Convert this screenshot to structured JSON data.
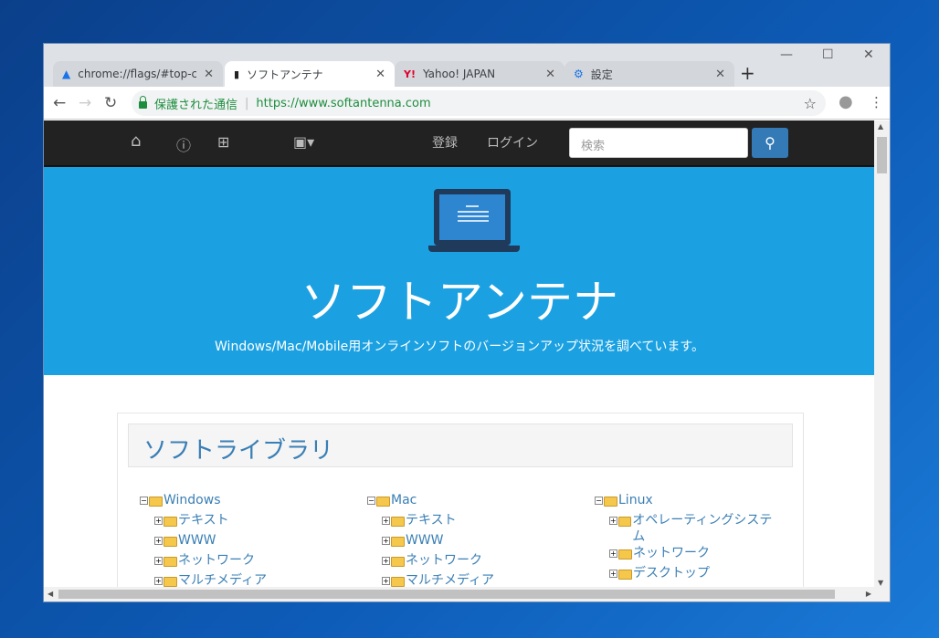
{
  "tabs": [
    {
      "title": "chrome://flags/#top-chrome-md",
      "icon": "flask-icon"
    },
    {
      "title": "ソフトアンテナ",
      "icon": "antenna-icon"
    },
    {
      "title": "Yahoo! JAPAN",
      "icon": "yahoo-icon"
    },
    {
      "title": "設定",
      "icon": "gear-icon"
    }
  ],
  "address": {
    "security": "保護された通信",
    "url": "https://www.softantenna.com"
  },
  "navbar": {
    "register": "登録",
    "login": "ログイン",
    "search_placeholder": "検索"
  },
  "hero": {
    "title": "ソフトアンテナ",
    "subtitle": "Windows/Mac/Mobile用オンラインソフトのバージョンアップ状況を調べています。"
  },
  "library": {
    "title": "ソフトライブラリ",
    "columns": [
      {
        "name": "Windows",
        "items": [
          "テキスト",
          "WWW",
          "ネットワーク",
          "マルチメディア"
        ]
      },
      {
        "name": "Mac",
        "items": [
          "テキスト",
          "WWW",
          "ネットワーク",
          "マルチメディア"
        ]
      },
      {
        "name": "Linux",
        "items": [
          "オペレーティングシステム",
          "ネットワーク",
          "デスクトップ"
        ]
      }
    ]
  },
  "colors": {
    "hero": "#1ba1e2",
    "navbar": "#222222",
    "link": "#3a7fb5"
  }
}
